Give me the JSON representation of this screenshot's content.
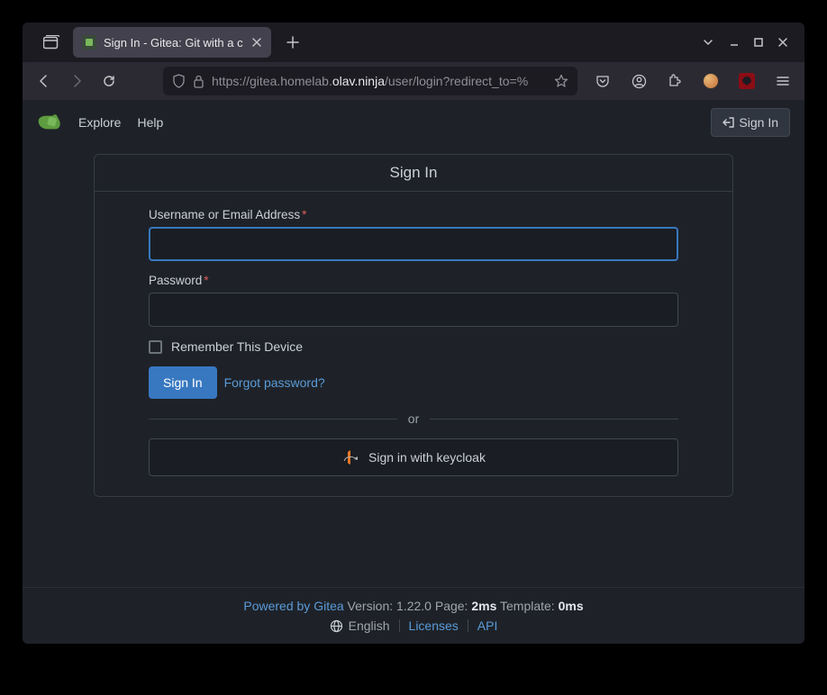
{
  "browser": {
    "tab_title": "Sign In - Gitea: Git with a c",
    "url_prefix": "https://gitea.homelab.",
    "url_domain": "olav.ninja",
    "url_path": "/user/login?redirect_to=%"
  },
  "nav": {
    "explore": "Explore",
    "help": "Help",
    "signin": "Sign In"
  },
  "form": {
    "heading": "Sign In",
    "username_label": "Username or Email Address",
    "password_label": "Password",
    "remember_label": "Remember This Device",
    "signin_button": "Sign In",
    "forgot_link": "Forgot password?",
    "divider": "or",
    "oauth_label": "Sign in with keycloak"
  },
  "footer": {
    "powered": "Powered by Gitea",
    "version_prefix": " Version: 1.22.0 Page: ",
    "page_time": "2ms",
    "template_prefix": " Template: ",
    "template_time": "0ms",
    "language": "English",
    "licenses": "Licenses",
    "api": "API"
  }
}
